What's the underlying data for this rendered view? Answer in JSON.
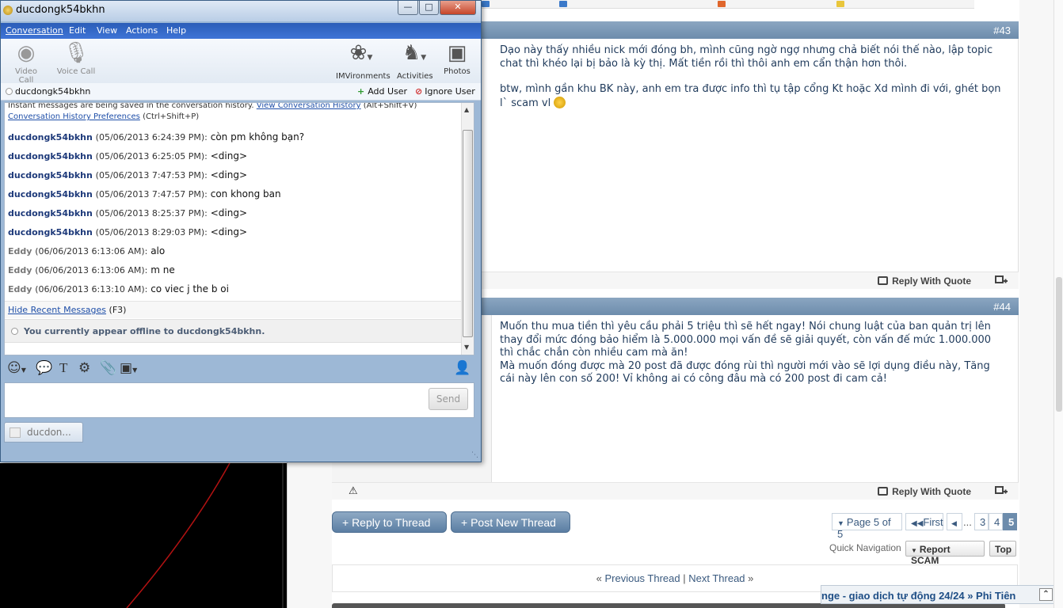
{
  "chat_window": {
    "title": "ducdongk54bkhn",
    "controls": {
      "minimize": "—",
      "maximize": "□",
      "close": "✕"
    },
    "menu": [
      "Conversation",
      "Edit",
      "View",
      "Actions",
      "Help"
    ],
    "toolbar": {
      "video_call": "Video Call",
      "voice_call": "Voice Call",
      "imvironments": "IMVironments",
      "activities": "Activities",
      "photos": "Photos"
    },
    "user": "ducdongk54bkhn",
    "add_user": "Add User",
    "ignore_user": "Ignore User",
    "notice": {
      "text1": "Instant messages are being saved in the conversation history.",
      "link1": "View Conversation History",
      "shortcut1": "(Alt+Shift+V)",
      "link2": "Conversation History Preferences",
      "shortcut2": "(Ctrl+Shift+P)"
    },
    "messages": [
      {
        "sender": "ducdongk54bkhn",
        "time": "(05/06/2013 6:24:39 PM):",
        "text": "còn pm không bạn?"
      },
      {
        "sender": "ducdongk54bkhn",
        "time": "(05/06/2013 6:25:05 PM):",
        "text": "<ding>"
      },
      {
        "sender": "ducdongk54bkhn",
        "time": "(05/06/2013 7:47:53 PM):",
        "text": "<ding>"
      },
      {
        "sender": "ducdongk54bkhn",
        "time": "(05/06/2013 7:47:57 PM):",
        "text": "con khong ban"
      },
      {
        "sender": "ducdongk54bkhn",
        "time": "(05/06/2013 8:25:37 PM):",
        "text": "<ding>"
      },
      {
        "sender": "ducdongk54bkhn",
        "time": "(05/06/2013 8:29:03 PM):",
        "text": "<ding>"
      },
      {
        "sender": "Eddy",
        "time": "(06/06/2013 6:13:06 AM):",
        "text": "alo"
      },
      {
        "sender": "Eddy",
        "time": "(06/06/2013 6:13:06 AM):",
        "text": "m ne"
      },
      {
        "sender": "Eddy",
        "time": "(06/06/2013 6:13:10 AM):",
        "text": "co viec j the b oi"
      }
    ],
    "hide_recent": "Hide Recent Messages",
    "hide_recent_key": "(F3)",
    "offline_note": "You currently appear offline to ducdongk54bkhn.",
    "send": "Send",
    "tab_label": "ducdon..."
  },
  "forum": {
    "post43": {
      "number": "#43",
      "paragraphs": [
        "Dạo này thấy nhiều nick mới đóng bh, mình cũng ngờ ngợ nhưng chả biết nói thế nào, lập topic chat thì khéo lại bị bảo là kỳ thị. Mất tiền rồi thì thôi anh em cẩn thận hơn thôi.",
        "btw, mình gần khu BK này, anh em tra được info thì tụ tập cổng Kt hoặc Xd mình đi với, ghét bọn l` scam vl"
      ],
      "reply_with_quote": "Reply With Quote"
    },
    "post44": {
      "number": "#44",
      "paragraphs": [
        "Muốn thu mua tiền thì yêu cầu phải 5 triệu thì sẽ hết ngay! Nói chung luật của ban quản trị lên thay đổi mức đóng bảo hiểm là 5.000.000 mọi vấn đề sẽ giải quyết, còn vấn đế mức 1.000.000 thì chắc chắn còn nhiều cam mà ăn!",
        "Mà muốn đóng được mà 20 post đã được đóng rùi thì người mới vào sẽ lợi dụng điều này, Tăng cái này lên con số 200! Vỉ không ai có công đâu mà có 200 post đi cam cả!"
      ],
      "reply_with_quote": "Reply With Quote"
    },
    "reply_to_thread": "+ Reply to Thread",
    "post_new_thread": "+ Post New Thread",
    "pager": {
      "page_of": "Page 5 of 5",
      "first": "First",
      "ellipsis": "...",
      "pages": [
        "3",
        "4",
        "5"
      ],
      "current": "5"
    },
    "quick_navigation": "Quick Navigation",
    "report_scam": "Report SCAM",
    "top": "Top",
    "previous_thread": "Previous Thread",
    "next_thread": "Next Thread",
    "ticker": "nge - giao dịch tự động 24/24   »  Phi Tiên"
  }
}
